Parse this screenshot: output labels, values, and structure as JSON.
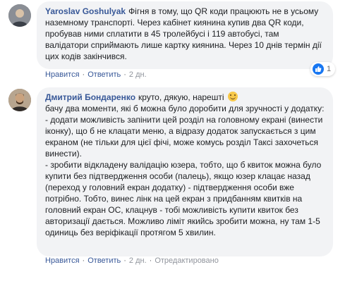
{
  "comments": [
    {
      "author": "Yaroslav Goshulyak",
      "text": "Фігня в тому, що QR коди працюють не в усьому наземному транспорті. Через кабінет киянина купив два QR коди, пробував ними сплатити в 45 тролейбусі і 119 автобусі, там валідатори сприймають лише картку киянина. Через 10 днів термін дії цих кодів закінчився.",
      "reaction_count": "1",
      "like_label": "Нравится",
      "reply_label": "Ответить",
      "time": "2 дн."
    },
    {
      "author": "Дмитрий Бондаренко",
      "text_first": "круто, дякую, нарешті",
      "text": "бачу два моменти, які б можна було доробити для зручності у додатку:\n- додати можливість запінити цей розділ на головному екрані (винести іконку), що б не клацати меню, а відразу додаток запускається з цим екраном (не тільки для цієї фічі, може комусь розділ Таксі захочеться винести).\n- зробити відкладену валідацію юзера, тобто, що б квиток можна було купити без підтвердження особи (палець), якщо юзер клацає назад (переход у головний екран додатку) - підтвердження особи вже потрібно. Тобто, винес лінк на цей екран з придбанням квитків на головний екран ОС, клацнув - тобі можливість купити квиток без авторизації дається. Можливо ліміт якийсь зробити можна, ну там 1-5 одиниць без веріфікації протягом 5 хвилин.",
      "like_label": "Нравится",
      "reply_label": "Ответить",
      "time": "2 дн.",
      "edited_label": "Отредактировано"
    }
  ],
  "colors": {
    "bubble": "#f2f3f5",
    "author": "#385898",
    "like_blue": "#1877f2"
  }
}
